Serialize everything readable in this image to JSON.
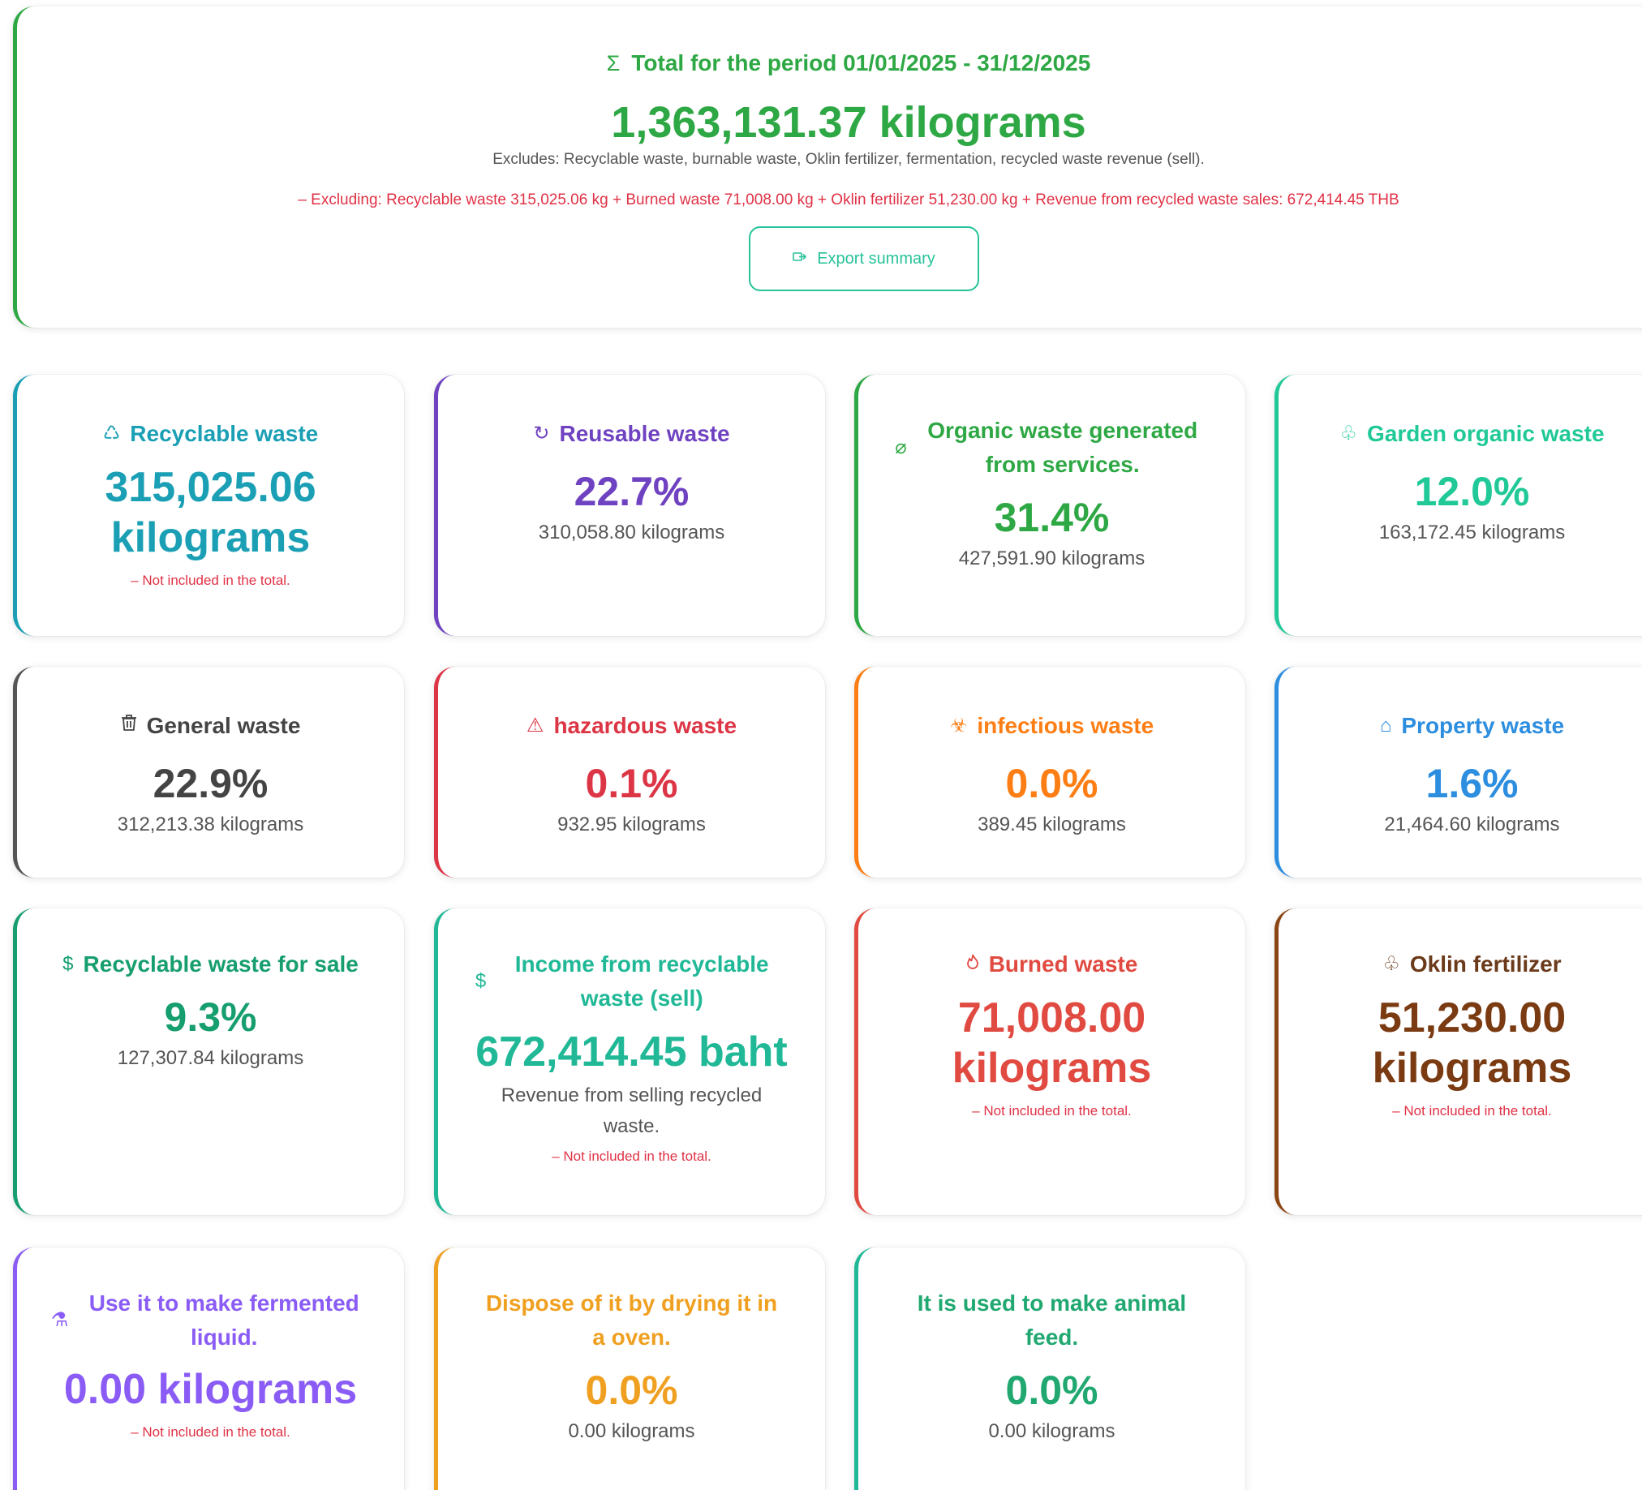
{
  "summary": {
    "sigma_icon": "Σ",
    "title": "Total for the period 01/01/2025 - 31/12/2025",
    "total": "1,363,131.37 kilograms",
    "excludes": "Excludes: Recyclable waste, burnable waste, Oklin fertilizer, fermentation, recycled waste revenue (sell).",
    "detail": "– Excluding: Recyclable waste 315,025.06 kg + Burned waste 71,008.00 kg + Oklin fertilizer 51,230.00 kg + Revenue from recycled waste sales: 672,414.45 THB",
    "export_icon": "export-icon",
    "export_label": "Export summary"
  },
  "colors": {
    "green": "#2ea844",
    "teal": "#1a9fb5",
    "purple": "#6f42c1",
    "mint": "#20c997",
    "gray": "#555555",
    "red": "#dc3545",
    "orange": "#fd7e14",
    "blue": "#2d8ee0",
    "sale_green": "#169e6e",
    "income_teal": "#20b896",
    "burn_red": "#e04a41",
    "brown": "#8b4513",
    "violet": "#8a5cf5",
    "amber": "#f0a020",
    "not_included": "#e03145"
  },
  "not_included_label": "– Not included in the total.",
  "cards": {
    "recyclable": {
      "icon": "recycle-icon",
      "glyph": "♺",
      "title": "Recyclable waste",
      "value_line1": "315,025.06",
      "value_line2": "kilograms"
    },
    "reusable": {
      "icon": "refresh-icon",
      "glyph": "↻",
      "title": "Reusable waste",
      "percent": "22.7%",
      "kg": "310,058.80 kilograms"
    },
    "organic_services": {
      "icon": "leaf-icon",
      "glyph": "⌀",
      "title": "Organic waste generated from services.",
      "percent": "31.4%",
      "kg": "427,591.90 kilograms"
    },
    "garden": {
      "icon": "sprout-icon",
      "glyph": "♧",
      "title": "Garden organic waste",
      "percent": "12.0%",
      "kg": "163,172.45 kilograms"
    },
    "general": {
      "icon": "trash-icon",
      "glyph": "🗑",
      "title": "General waste",
      "percent": "22.9%",
      "kg": "312,213.38 kilograms"
    },
    "hazardous": {
      "icon": "warning-icon",
      "glyph": "⚠",
      "title": "hazardous waste",
      "percent": "0.1%",
      "kg": "932.95 kilograms"
    },
    "infectious": {
      "icon": "biohazard-icon",
      "glyph": "☣",
      "title": "infectious waste",
      "percent": "0.0%",
      "kg": "389.45 kilograms"
    },
    "property": {
      "icon": "house-icon",
      "glyph": "⌂",
      "title": "Property waste",
      "percent": "1.6%",
      "kg": "21,464.60 kilograms"
    },
    "sale": {
      "icon": "dollar-icon",
      "glyph": "$",
      "title": "Recyclable waste for sale",
      "percent": "9.3%",
      "kg": "127,307.84 kilograms"
    },
    "income": {
      "icon": "dollar-icon",
      "glyph": "$",
      "title": "Income from recyclable waste (sell)",
      "value": "672,414.45 baht",
      "desc": "Revenue from selling recycled waste."
    },
    "burned": {
      "icon": "flame-icon",
      "glyph": "🔥",
      "title": "Burned waste",
      "value_line1": "71,008.00",
      "value_line2": "kilograms"
    },
    "oklin": {
      "icon": "sprout-icon",
      "glyph": "♧",
      "title": "Oklin fertilizer",
      "value_line1": "51,230.00",
      "value_line2": "kilograms"
    },
    "fermented": {
      "icon": "flask-icon",
      "glyph": "⚗",
      "title": "Use it to make fermented liquid.",
      "value": "0.00 kilograms"
    },
    "oven": {
      "title": "Dispose of it by drying it in a oven.",
      "percent": "0.0%",
      "kg": "0.00 kilograms"
    },
    "feed": {
      "title": "It is used to make animal feed.",
      "percent": "0.0%",
      "kg": "0.00 kilograms"
    }
  }
}
